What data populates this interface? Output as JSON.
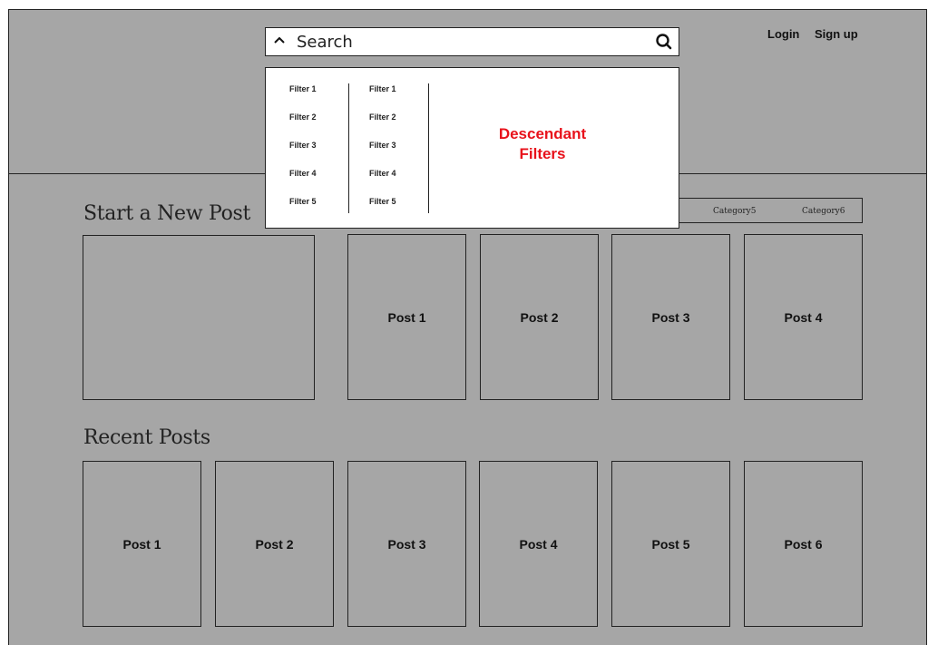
{
  "header": {
    "search": {
      "placeholder": "Search",
      "toggle_icon": "chevron-up-icon",
      "search_icon": "search-icon"
    },
    "login_label": "Login",
    "signup_label": "Sign up"
  },
  "filters": {
    "column1": [
      "Filter 1",
      "Filter 2",
      "Filter 3",
      "Filter 4",
      "Filter 5"
    ],
    "column2": [
      "Filter 1",
      "Filter 2",
      "Filter 3",
      "Filter 4",
      "Filter 5"
    ],
    "descendant_label_line1": "Descendant",
    "descendant_label_line2": "Filters"
  },
  "categories": {
    "items": [
      "Category5",
      "Category6"
    ]
  },
  "new_post_section": {
    "title": "Start a New Post",
    "posts": [
      "Post 1",
      "Post 2",
      "Post 3",
      "Post 4"
    ]
  },
  "recent_section": {
    "title": "Recent Posts",
    "posts": [
      "Post 1",
      "Post 2",
      "Post 3",
      "Post 4",
      "Post 5",
      "Post 6"
    ]
  },
  "colors": {
    "page_background": "#a6a6a6",
    "accent_red": "#e8121b",
    "panel": "#ffffff"
  }
}
